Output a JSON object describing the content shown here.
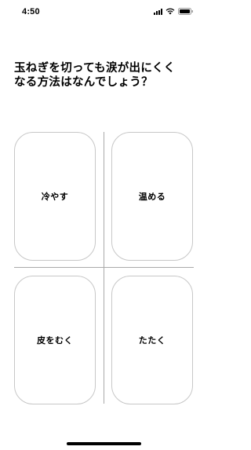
{
  "status_bar": {
    "time": "4:50",
    "icons": [
      "signal-icon",
      "wifi-icon",
      "battery-icon"
    ]
  },
  "question": {
    "line1": "玉ねぎを切っても涙が出にくく",
    "line2": "なる方法はなんでしょう？"
  },
  "options": [
    {
      "label": "冷やす"
    },
    {
      "label": "温める"
    },
    {
      "label": "皮をむく"
    },
    {
      "label": "たたく"
    }
  ],
  "colors": {
    "text": "#000000",
    "card_border": "#c7c7c7",
    "divider": "#a9a9a9",
    "background": "#ffffff"
  }
}
